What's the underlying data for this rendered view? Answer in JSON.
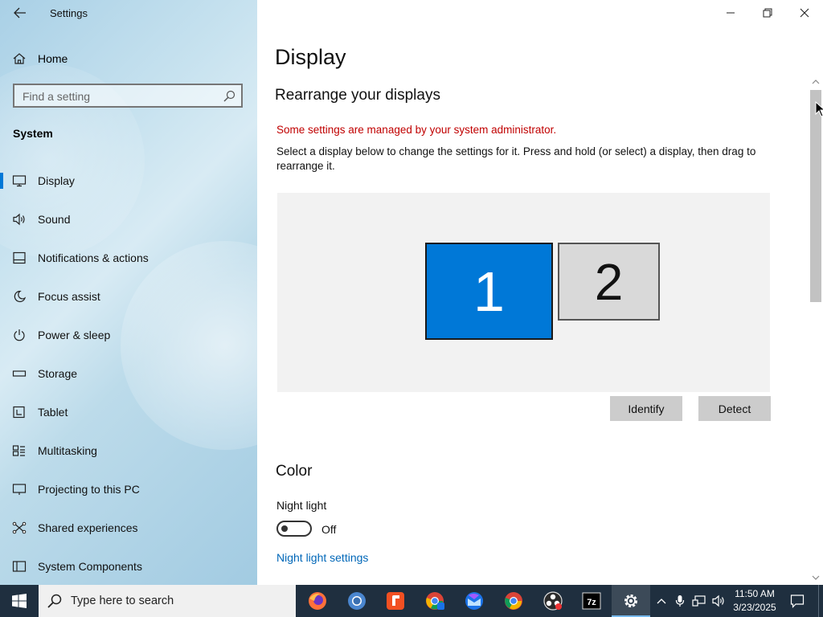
{
  "app": {
    "title": "Settings"
  },
  "sidebar": {
    "home_label": "Home",
    "search_placeholder": "Find a setting",
    "section": "System",
    "items": [
      {
        "label": "Display",
        "icon": "monitor-icon",
        "selected": true
      },
      {
        "label": "Sound",
        "icon": "speaker-icon"
      },
      {
        "label": "Notifications & actions",
        "icon": "notifications-icon"
      },
      {
        "label": "Focus assist",
        "icon": "moon-icon"
      },
      {
        "label": "Power & sleep",
        "icon": "power-icon"
      },
      {
        "label": "Storage",
        "icon": "storage-icon"
      },
      {
        "label": "Tablet",
        "icon": "tablet-icon"
      },
      {
        "label": "Multitasking",
        "icon": "multitasking-icon"
      },
      {
        "label": "Projecting to this PC",
        "icon": "projector-icon"
      },
      {
        "label": "Shared experiences",
        "icon": "shared-icon"
      },
      {
        "label": "System Components",
        "icon": "components-icon"
      }
    ]
  },
  "main": {
    "title": "Display",
    "rearrange_title": "Rearrange your displays",
    "admin_warning": "Some settings are managed by your system administrator.",
    "description": "Select a display below to change the settings for it. Press and hold (or select) a display, then drag to rearrange it.",
    "displays": [
      {
        "number": "1",
        "selected": true
      },
      {
        "number": "2",
        "selected": false
      }
    ],
    "identify_label": "Identify",
    "detect_label": "Detect",
    "color_title": "Color",
    "night_light_label": "Night light",
    "night_light_state": "Off",
    "night_light_link": "Night light settings"
  },
  "taskbar": {
    "search_placeholder": "Type here to search",
    "apps": [
      "firefox",
      "chromium",
      "foxit-reader",
      "chrome-beta",
      "thunderbird",
      "chrome",
      "obs",
      "7zip",
      "settings"
    ],
    "time": "11:50 AM",
    "date": "3/23/2025"
  },
  "colors": {
    "accent": "#0078d7",
    "warning": "#c00000",
    "link": "#0067b8",
    "taskbar": "#1f2f3f"
  }
}
